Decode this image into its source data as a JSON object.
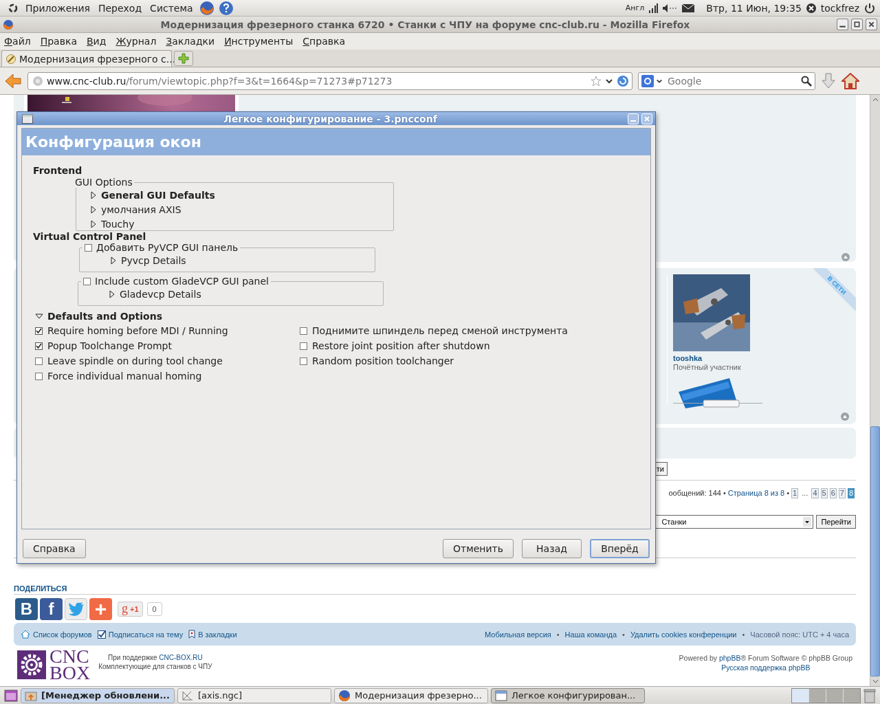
{
  "top_panel": {
    "menus": [
      "Приложения",
      "Переход",
      "Система"
    ],
    "keyboard": "Англ",
    "datetime": "Втр, 11 Июн, 19:35",
    "user": "tockfrez"
  },
  "browser": {
    "title": "Модернизация фрезерного станка 6720 • Станки с ЧПУ на форуме cnc-club.ru - Mozilla Firefox",
    "menu": [
      "Файл",
      "Правка",
      "Вид",
      "Журнал",
      "Закладки",
      "Инструменты",
      "Справка"
    ],
    "tabs": [
      {
        "label": "Модернизация фрезерного с...",
        "selected": true
      }
    ],
    "url": {
      "host": "www.cnc-club.ru",
      "path": "/forum/viewtopic.php?f=3&t=1664&p=71273#p71273"
    },
    "search": {
      "placeholder": "Google"
    }
  },
  "page": {
    "post": {
      "online_label": "В СЕТИ",
      "author": "tooshka",
      "rank": "Почётный участник"
    },
    "reply_button": "ти",
    "post_count": "ообщений: 144",
    "separator": "•",
    "page_label": "Страница 8 из 8",
    "pages": [
      {
        "label": "1",
        "kind": "page",
        "selected": false
      },
      {
        "label": "...",
        "kind": "gap",
        "selected": false
      },
      {
        "label": "4",
        "kind": "page",
        "selected": false
      },
      {
        "label": "5",
        "kind": "page",
        "selected": false
      },
      {
        "label": "6",
        "kind": "page",
        "selected": false
      },
      {
        "label": "7",
        "kind": "page",
        "selected": false
      },
      {
        "label": "8",
        "kind": "page",
        "selected": true
      }
    ],
    "jump": {
      "value": "Станки",
      "button": "Перейти"
    },
    "share": {
      "title": "ПОДЕЛИТЬСЯ",
      "buttons": [
        {
          "kind": "vk",
          "glyph": "B"
        },
        {
          "kind": "facebook",
          "glyph": "f"
        },
        {
          "kind": "twitter"
        },
        {
          "kind": "addthis",
          "glyph": "+"
        }
      ],
      "gplus": {
        "glyph": "g",
        "label": "+1",
        "count": "0"
      }
    },
    "navbar": {
      "left": [
        {
          "kind": "home",
          "label": "Список форумов"
        },
        {
          "kind": "subscribe",
          "label": "Подписаться на тему"
        },
        {
          "kind": "bookmark",
          "label": "В закладки"
        }
      ],
      "right": [
        "Мобильная версия",
        "Наша команда",
        "Удалить cookies конференции"
      ],
      "timezone": "Часовой пояс: UTC + 4 часа"
    },
    "footer": {
      "logo": [
        "CNC",
        "BOX"
      ],
      "sponsor_prefix": "При поддержке",
      "sponsor_link": "CNC-BOX.RU",
      "sponsor_note": "Комплектующие для станков с ЧПУ",
      "powered_prefix": "Powered by",
      "powered_link": "phpBB",
      "powered_suffix": "® Forum Software © phpBB Group",
      "support_link": "Русская поддержка phpBB"
    }
  },
  "dialog": {
    "title": "Легкое конфигурирование - 3.pncconf",
    "header": "Конфигурация окон",
    "frontend": {
      "heading": "Frontend",
      "frame_label": "GUI Options",
      "items": [
        {
          "label": "General GUI Defaults",
          "emphasized": true,
          "expanded": false
        },
        {
          "label": "умолчания AXIS",
          "emphasized": false,
          "expanded": false
        },
        {
          "label": "Touchy",
          "emphasized": false,
          "expanded": false
        }
      ]
    },
    "vcp": {
      "heading": "Virtual Control Panel",
      "panels": [
        {
          "label": "Добавить PyVCP GUI панель",
          "checked": false,
          "details": {
            "label": "Pyvcp Details",
            "expanded": false
          }
        },
        {
          "label": "Include custom GladeVCP GUI panel",
          "checked": false,
          "details": {
            "label": "Gladevcp Details",
            "expanded": false
          }
        }
      ]
    },
    "options": {
      "label": "Defaults and Options",
      "expanded": true,
      "columns": [
        [
          {
            "label": "Require homing before MDI / Running",
            "checked": true
          },
          {
            "label": "Popup Toolchange Prompt",
            "checked": true
          },
          {
            "label": "Leave spindle on during tool change",
            "checked": false
          },
          {
            "label": "Force individual manual homing",
            "checked": false
          }
        ],
        [
          {
            "label": "Поднимите шпиндель перед сменой инструмента",
            "checked": false
          },
          {
            "label": "Restore joint position after shutdown",
            "checked": false
          },
          {
            "label": "Random position toolchanger",
            "checked": false
          }
        ]
      ]
    },
    "buttons": [
      {
        "label": "Справка",
        "kind": "help",
        "default": false
      },
      {
        "label": "Отменить",
        "kind": "action",
        "default": false
      },
      {
        "label": "Назад",
        "kind": "action",
        "default": false
      },
      {
        "label": "Вперёд",
        "kind": "action",
        "default": true
      }
    ]
  },
  "taskbar": {
    "tasks": [
      {
        "label": "[Менеджер обновлени...",
        "kind": "updates",
        "active": false,
        "attention": true
      },
      {
        "label": "[axis.ngc]",
        "kind": "editor",
        "active": false,
        "attention": false
      },
      {
        "label": "Модернизация фрезерно...",
        "kind": "browser",
        "active": false,
        "attention": false
      },
      {
        "label": "Легкое конфигурирован...",
        "kind": "window",
        "active": true,
        "attention": false
      }
    ]
  }
}
